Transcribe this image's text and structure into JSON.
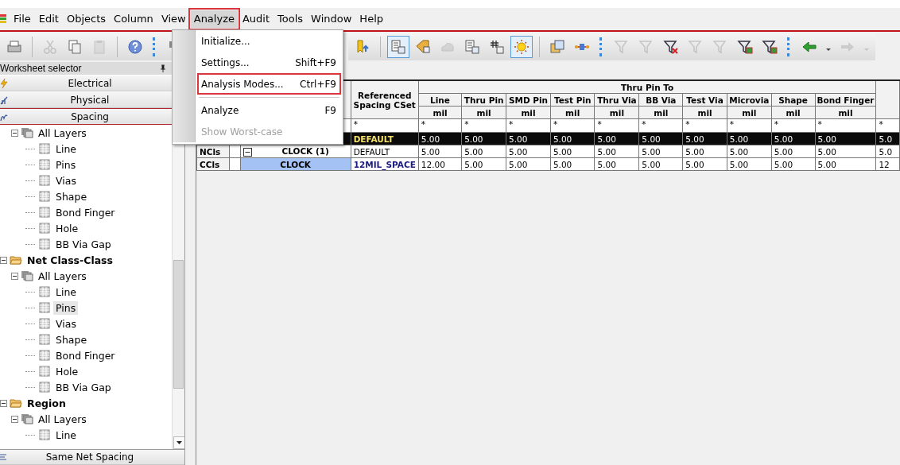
{
  "menu_bar": [
    {
      "label": "File",
      "selected": false
    },
    {
      "label": "Edit",
      "selected": false
    },
    {
      "label": "Objects",
      "selected": false
    },
    {
      "label": "Column",
      "selected": false
    },
    {
      "label": "View",
      "selected": false
    },
    {
      "label": "Analyze",
      "selected": true
    },
    {
      "label": "Audit",
      "selected": false
    },
    {
      "label": "Tools",
      "selected": false
    },
    {
      "label": "Window",
      "selected": false
    },
    {
      "label": "Help",
      "selected": false
    }
  ],
  "analyze_menu": [
    {
      "kind": "item",
      "label": "Initialize...",
      "highlighted": false,
      "disabled": false
    },
    {
      "kind": "item",
      "label": "Settings...",
      "shortcut": "Shift+F9",
      "highlighted": false,
      "disabled": false
    },
    {
      "kind": "item",
      "label": "Analysis Modes...",
      "shortcut": "Ctrl+F9",
      "highlighted": true,
      "disabled": false
    },
    {
      "kind": "separator"
    },
    {
      "kind": "item",
      "label": "Analyze",
      "shortcut": "F9",
      "highlighted": false,
      "disabled": false
    },
    {
      "kind": "item",
      "label": "Show Worst-case",
      "highlighted": false,
      "disabled": true
    }
  ],
  "toolbar_left": [
    {
      "kind": "printer",
      "disabled": false,
      "selected": false
    },
    {
      "kind": "separator"
    },
    {
      "kind": "scissors",
      "disabled": true,
      "selected": false
    },
    {
      "kind": "copy",
      "disabled": false,
      "selected": false
    },
    {
      "kind": "paste",
      "disabled": true,
      "selected": false
    },
    {
      "kind": "separator"
    },
    {
      "kind": "help",
      "disabled": false,
      "selected": false
    },
    {
      "kind": "grip"
    },
    {
      "kind": "objects",
      "disabled": false,
      "selected": false
    }
  ],
  "toolbar_right": [
    {
      "kind": "bookmark",
      "disabled": false,
      "selected": false
    },
    {
      "kind": "separator"
    },
    {
      "kind": "sheet",
      "disabled": false,
      "selected": true
    },
    {
      "kind": "tag",
      "disabled": false,
      "selected": false
    },
    {
      "kind": "cloud",
      "disabled": true,
      "selected": false
    },
    {
      "kind": "sheet",
      "disabled": false,
      "selected": false
    },
    {
      "kind": "hash",
      "disabled": false,
      "selected": false
    },
    {
      "kind": "sun",
      "disabled": false,
      "selected": true
    },
    {
      "kind": "separator"
    },
    {
      "kind": "windows",
      "disabled": false,
      "selected": false
    },
    {
      "kind": "connector",
      "disabled": false,
      "selected": false
    },
    {
      "kind": "grip"
    },
    {
      "kind": "filter",
      "disabled": true,
      "selected": false
    },
    {
      "kind": "filter",
      "disabled": true,
      "selected": false
    },
    {
      "kind": "filter-x",
      "disabled": false,
      "selected": false
    },
    {
      "kind": "filter",
      "disabled": true,
      "selected": false
    },
    {
      "kind": "filter",
      "disabled": true,
      "selected": false
    },
    {
      "kind": "filter-grid",
      "disabled": false,
      "selected": false
    },
    {
      "kind": "filter-grid",
      "disabled": false,
      "selected": false
    },
    {
      "kind": "grip"
    },
    {
      "kind": "arrow-left",
      "disabled": false,
      "selected": false
    },
    {
      "kind": "dropdown",
      "disabled": false,
      "selected": false
    },
    {
      "kind": "arrow-right",
      "disabled": true,
      "selected": false
    },
    {
      "kind": "dropdown",
      "disabled": true,
      "selected": false
    }
  ],
  "worksheet_selector": {
    "title": "Worksheet selector",
    "categories": [
      {
        "kind": "electrical",
        "label": "Electrical",
        "selected": false
      },
      {
        "kind": "physical",
        "label": "Physical",
        "selected": false
      },
      {
        "kind": "spacing",
        "label": "Spacing",
        "selected": true
      }
    ],
    "tree": [
      {
        "children": [
          {
            "kind": "layers",
            "label": "All Layers",
            "expanded": true,
            "selected": false,
            "children": [
              {
                "kind": "sheet",
                "label": "Line",
                "selected": false
              },
              {
                "kind": "sheet",
                "label": "Pins",
                "selected": false
              },
              {
                "kind": "sheet",
                "label": "Vias",
                "selected": false
              },
              {
                "kind": "sheet",
                "label": "Shape",
                "selected": false
              },
              {
                "kind": "sheet",
                "label": "Bond Finger",
                "selected": false
              },
              {
                "kind": "sheet",
                "label": "Hole",
                "selected": false
              },
              {
                "kind": "sheet",
                "label": "BB Via Gap",
                "selected": false
              }
            ]
          }
        ]
      },
      {
        "kind": "folder",
        "label": "Net Class-Class",
        "expanded": true,
        "selected": false,
        "children": [
          {
            "kind": "layers",
            "label": "All Layers",
            "expanded": true,
            "selected": false,
            "children": [
              {
                "kind": "sheet",
                "label": "Line",
                "selected": false
              },
              {
                "kind": "sheet",
                "label": "Pins",
                "selected": true
              },
              {
                "kind": "sheet",
                "label": "Vias",
                "selected": false
              },
              {
                "kind": "sheet",
                "label": "Shape",
                "selected": false
              },
              {
                "kind": "sheet",
                "label": "Bond Finger",
                "selected": false
              },
              {
                "kind": "sheet",
                "label": "Hole",
                "selected": false
              },
              {
                "kind": "sheet",
                "label": "BB Via Gap",
                "selected": false
              }
            ]
          }
        ]
      },
      {
        "kind": "folder",
        "label": "Region",
        "expanded": true,
        "selected": false,
        "children": [
          {
            "kind": "layers",
            "label": "All Layers",
            "expanded": true,
            "selected": false,
            "children": [
              {
                "kind": "sheet",
                "label": "Line",
                "selected": false
              }
            ]
          }
        ]
      }
    ],
    "bottom_category": {
      "kind": "same-net",
      "label": "Same Net Spacing"
    }
  },
  "grid": {
    "group_header": "Thru Pin To",
    "ref_header": "Referenced Spacing CSet",
    "ref_filter": "*",
    "columns": [
      {
        "name": "Line",
        "unit": "mil",
        "filter": "*"
      },
      {
        "name": "Thru Pin",
        "unit": "mil",
        "filter": "*"
      },
      {
        "name": "SMD Pin",
        "unit": "mil",
        "filter": "*"
      },
      {
        "name": "Test Pin",
        "unit": "mil",
        "filter": "*"
      },
      {
        "name": "Thru Via",
        "unit": "mil",
        "filter": "*"
      },
      {
        "name": "BB Via",
        "unit": "mil",
        "filter": "*"
      },
      {
        "name": "Test Via",
        "unit": "mil",
        "filter": "*"
      },
      {
        "name": "Microvia",
        "unit": "mil",
        "filter": "*"
      },
      {
        "name": "Shape",
        "unit": "mil",
        "filter": "*"
      },
      {
        "name": "Bond Finger",
        "unit": "mil",
        "filter": "*"
      },
      {
        "filter": "*"
      }
    ],
    "rows": [
      {
        "kind": "design",
        "selected": true,
        "ref": "DEFAULT",
        "values": [
          "5.00",
          "5.00",
          "5.00",
          "5.00",
          "5.00",
          "5.00",
          "5.00",
          "5.00",
          "5.00",
          "5.00",
          "5.0"
        ]
      },
      {
        "kind": "net_class",
        "selected": false,
        "type": "NCls",
        "name": "CLOCK (1)",
        "expanded": true,
        "ref": "DEFAULT",
        "values": [
          "5.00",
          "5.00",
          "5.00",
          "5.00",
          "5.00",
          "5.00",
          "5.00",
          "5.00",
          "5.00",
          "5.00",
          "5.0"
        ]
      },
      {
        "kind": "class_class",
        "selected": false,
        "type": "CCls",
        "name": "CLOCK",
        "ref": "12MIL_SPACE",
        "values": [
          "12.00",
          "5.00",
          "5.00",
          "5.00",
          "5.00",
          "5.00",
          "5.00",
          "5.00",
          "5.00",
          "5.00",
          "12"
        ]
      }
    ]
  }
}
